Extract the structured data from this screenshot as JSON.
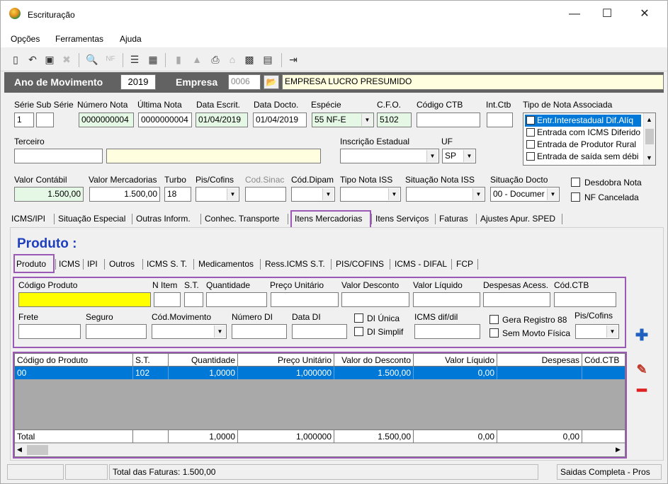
{
  "window": {
    "title": "Escrituração",
    "minimize": "—",
    "maximize": "☐",
    "close": "✕"
  },
  "menu": [
    "Opções",
    "Ferramentas",
    "Ajuda"
  ],
  "yearbar": {
    "ano_label": "Ano de Movimento",
    "ano_value": "2019",
    "empresa_label": "Empresa",
    "empresa_code": "0006",
    "empresa_name": "EMPRESA LUCRO PRESUMIDO"
  },
  "row1": {
    "serie_label": "Série",
    "serie_value": "1",
    "subserie_label": "Sub Série",
    "subserie_value": "",
    "numero_label": "Número Nota",
    "numero_value": "0000000004",
    "ultima_label": "Última Nota",
    "ultima_value": "0000000004",
    "data_escrit_label": "Data Escrit.",
    "data_escrit_value": "01/04/2019",
    "data_docto_label": "Data Docto.",
    "data_docto_value": "01/04/2019",
    "especie_label": "Espécie",
    "especie_value": "55  NF-E",
    "cfo_label": "C.F.O.",
    "cfo_value": "5102",
    "codigo_ctb_label": "Código CTB",
    "codigo_ctb_value": "",
    "int_ctb_label": "Int.Ctb",
    "int_ctb_value": "",
    "tipo_nota_label": "Tipo de Nota Associada"
  },
  "tipo_nota_items": [
    {
      "label": "Entr.Interestadual Dif.Alíq",
      "selected": true
    },
    {
      "label": "Entrada com ICMS Diferido",
      "selected": false
    },
    {
      "label": "Entrada de Produtor Rural",
      "selected": false
    },
    {
      "label": "Entrada de saída sem débi",
      "selected": false
    }
  ],
  "row2": {
    "terceiro_label": "Terceiro",
    "inscricao_label": "Inscrição Estadual",
    "uf_label": "UF",
    "uf_value": "SP"
  },
  "row3": {
    "valor_contabil_label": "Valor Contábil",
    "valor_contabil_value": "1.500,00",
    "valor_merc_label": "Valor Mercadorias",
    "valor_merc_value": "1.500,00",
    "turbo_label": "Turbo",
    "turbo_value": "18",
    "pis_label": "Pis/Cofins",
    "cod_sinac_label": "Cod.Sinac",
    "cod_dipam_label": "Cód.Dipam",
    "tipo_iss_label": "Tipo Nota ISS",
    "sit_iss_label": "Situação Nota ISS",
    "sit_docto_label": "Situação Docto",
    "sit_docto_value": "00 - Documer",
    "desdobra_label": "Desdobra Nota",
    "nf_cancelada_label": "NF Cancelada"
  },
  "main_tabs": [
    "ICMS/IPI",
    "Situação Especial",
    "Outras Inform.",
    "Conhec. Transporte",
    "Itens Mercadorias",
    "Itens Serviços",
    "Faturas",
    "Ajustes Apur. SPED"
  ],
  "produto_title": "Produto :",
  "sub_tabs": [
    "Produto",
    "ICMS",
    "IPI",
    "Outros",
    "ICMS S. T.",
    "Medicamentos",
    "Ress.ICMS S.T.",
    "PIS/COFINS",
    "ICMS - DIFAL",
    "FCP"
  ],
  "produto_form": {
    "codigo_label": "Código Produto",
    "nitem_label": "N Item",
    "st_label": "S.T.",
    "quantidade_label": "Quantidade",
    "preco_label": "Preço Unitário",
    "desconto_label": "Valor Desconto",
    "liquido_label": "Valor Líquido",
    "despesas_label": "Despesas Acess.",
    "codctb_label": "Cód.CTB",
    "frete_label": "Frete",
    "seguro_label": "Seguro",
    "codmov_label": "Cód.Movimento",
    "numdi_label": "Número DI",
    "datadi_label": "Data DI",
    "di_unica_label": "DI Única",
    "di_simplif_label": "DI Simplif",
    "icms_dif_label": "ICMS dif/dil",
    "gera_reg_label": "Gera Registro 88",
    "sem_movto_label": "Sem Movto Física",
    "pis_label": "Pis/Cofins"
  },
  "grid": {
    "headers": [
      "Código do Produto",
      "S.T.",
      "Quantidade",
      "Preço Unitário",
      "Valor do Desconto",
      "Valor Líquido",
      "Despesas",
      "Cód.CTB"
    ],
    "row": [
      "00",
      "102",
      "1,0000",
      "1,000000",
      "1.500,00",
      "0,00",
      "",
      ""
    ],
    "total": [
      "Total",
      "",
      "1,0000",
      "1,000000",
      "1.500,00",
      "0,00",
      "0,00",
      ""
    ]
  },
  "status": {
    "total_faturas": "Total das Faturas: 1.500,00",
    "right": "Saidas Completa - Pros"
  },
  "colors": {
    "accent_purple": "#9b59b6",
    "selection_blue": "#0078d7",
    "yearbar_gray": "#626262",
    "produto_blue": "#1f3fbf"
  }
}
